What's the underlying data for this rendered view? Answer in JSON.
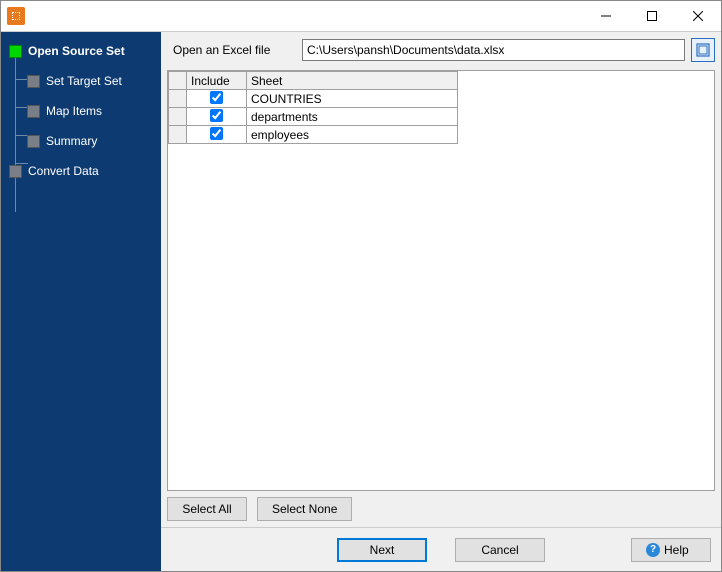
{
  "titlebar": {
    "minimize_tooltip": "Minimize",
    "maximize_tooltip": "Maximize",
    "close_tooltip": "Close"
  },
  "nav": {
    "items": [
      {
        "label": "Open Source Set",
        "active": true
      },
      {
        "label": "Set Target Set",
        "active": false
      },
      {
        "label": "Map Items",
        "active": false
      },
      {
        "label": "Summary",
        "active": false
      },
      {
        "label": "Convert Data",
        "active": false
      }
    ]
  },
  "file": {
    "label": "Open an Excel file",
    "path": "C:\\Users\\pansh\\Documents\\data.xlsx"
  },
  "sheets": {
    "headers": {
      "include": "Include",
      "sheet": "Sheet"
    },
    "rows": [
      {
        "include": true,
        "sheet": "COUNTRIES"
      },
      {
        "include": true,
        "sheet": "departments"
      },
      {
        "include": true,
        "sheet": "employees"
      }
    ]
  },
  "buttons": {
    "select_all": "Select All",
    "select_none": "Select None",
    "next": "Next",
    "cancel": "Cancel",
    "help": "Help"
  }
}
